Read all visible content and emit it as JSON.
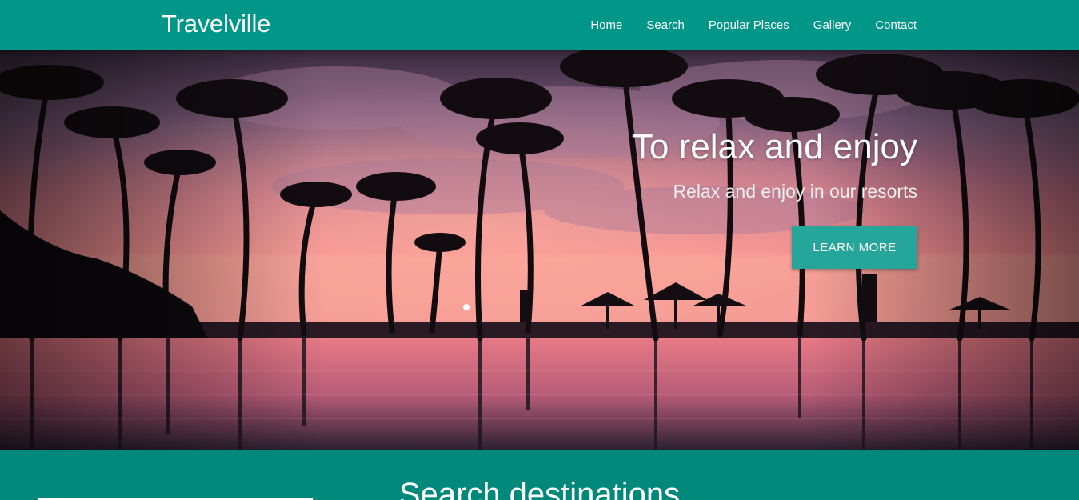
{
  "header": {
    "brand": "Travelville",
    "nav": [
      {
        "label": "Home"
      },
      {
        "label": "Search"
      },
      {
        "label": "Popular Places"
      },
      {
        "label": "Gallery"
      },
      {
        "label": "Contact"
      }
    ]
  },
  "hero": {
    "title": "To relax and enjoy",
    "subtitle": "Relax and enjoy in our resorts",
    "button_label": "LEARN MORE",
    "image_subject": "palm-trees-sunset-resort-pool",
    "slides": {
      "active": 1
    }
  },
  "search": {
    "title": "Search destinations"
  },
  "colors": {
    "primary": "#009688",
    "section": "#00897b",
    "button": "#26a69a",
    "text": "#ffffff"
  }
}
